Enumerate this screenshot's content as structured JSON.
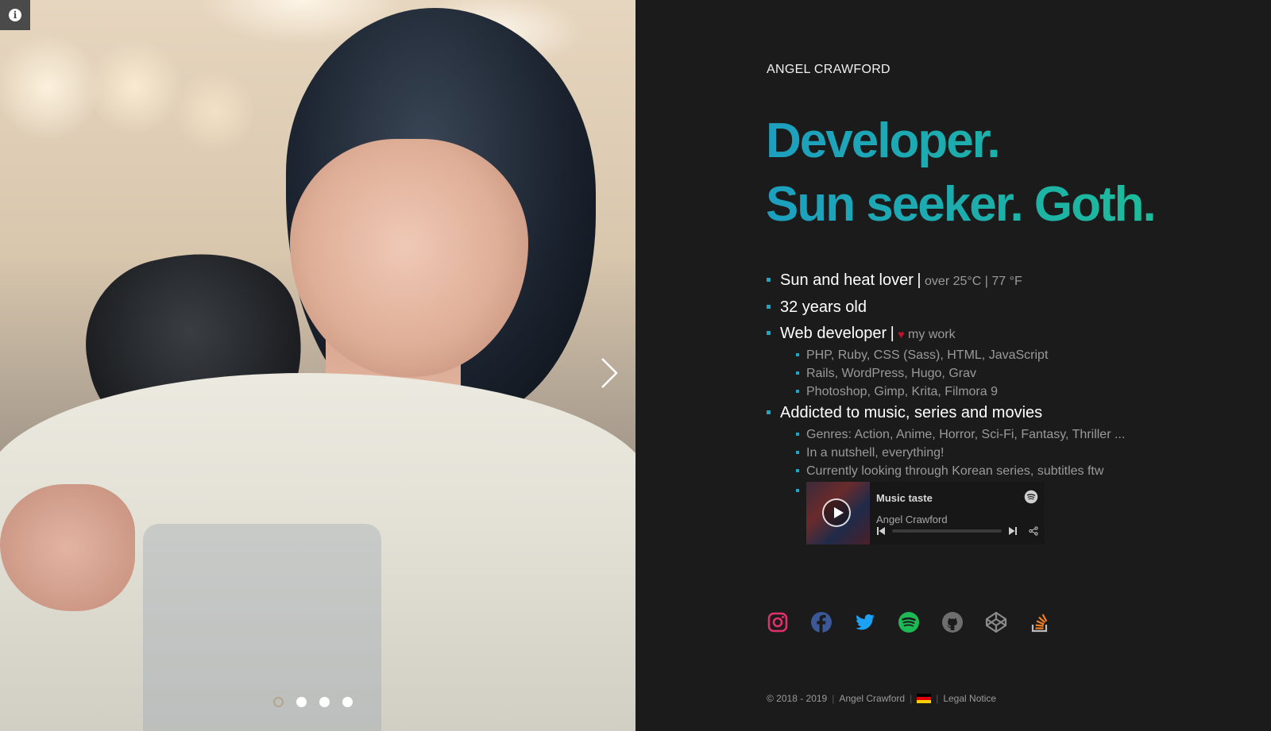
{
  "profile": {
    "name": "ANGEL CRAWFORD",
    "tagline_line1": "Developer.",
    "tagline_line2": "Sun seeker. Goth."
  },
  "facts": [
    {
      "main": "Sun and heat lover",
      "separator": "|",
      "note": "over 25°C | 77 °F"
    },
    {
      "main": "32 years old"
    },
    {
      "main": "Web developer",
      "separator": "|",
      "note_icon": "heart-icon",
      "note": "my work",
      "sub": [
        "PHP, Ruby, CSS (Sass), HTML, JavaScript",
        "Rails, WordPress, Hugo, Grav",
        "Photoshop, Gimp, Krita, Filmora 9"
      ]
    },
    {
      "main": "Addicted to music, series and movies",
      "sub": [
        "Genres: Action, Anime, Horror, Sci-Fi, Fantasy, Thriller ...",
        "In a nutshell, everything!",
        "Currently looking through Korean series, subtitles ftw"
      ]
    }
  ],
  "player": {
    "title": "Music taste",
    "artist": "Angel Crawford",
    "icons": [
      "play-icon",
      "spotify-icon",
      "previous-track-icon",
      "next-track-icon",
      "share-icon"
    ]
  },
  "socials": [
    {
      "name": "instagram-icon",
      "color": "#e1306c"
    },
    {
      "name": "facebook-icon",
      "color": "#3b5998"
    },
    {
      "name": "twitter-icon",
      "color": "#1da1f2"
    },
    {
      "name": "spotify-icon",
      "color": "#1db954"
    },
    {
      "name": "github-icon",
      "color": "#6e6e6e"
    },
    {
      "name": "codepen-icon",
      "color": "#8a8a8a"
    },
    {
      "name": "stackoverflow-icon",
      "color": "#f48024"
    }
  ],
  "footer": {
    "copyright": "© 2018 - 2019",
    "author": "Angel Crawford",
    "legal": "Legal Notice",
    "flag_colors": [
      "#000000",
      "#dd0000",
      "#ffce00"
    ]
  },
  "slider": {
    "slide_count": 4,
    "active_index": 0,
    "icons": [
      "info-icon",
      "chevron-right-icon"
    ]
  },
  "colors": {
    "background": "#1b1b1b",
    "accent_start": "#1d9fc0",
    "accent_end": "#1dbb9a",
    "bullet": "#1ea6c4",
    "heart": "#c8102e"
  }
}
